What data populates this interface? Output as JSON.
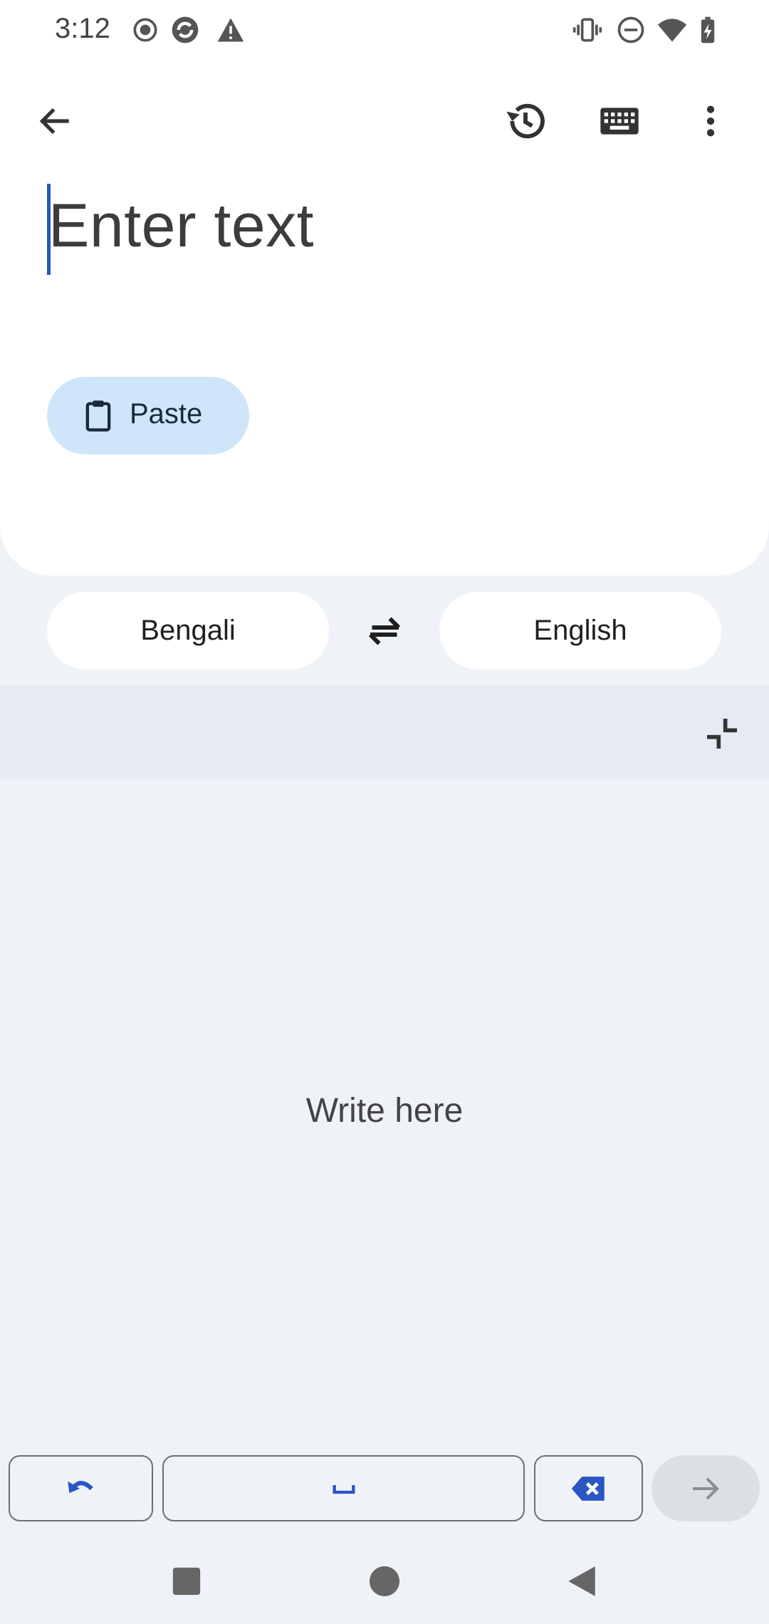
{
  "status_bar": {
    "time": "3:12",
    "left_icons": [
      "record-icon",
      "app-notification-icon",
      "warning-icon"
    ],
    "right_icons": [
      "vibrate-icon",
      "do-not-disturb-icon",
      "wifi-icon",
      "battery-charging-icon"
    ]
  },
  "toolbar": {
    "back_icon": "arrow-left-icon",
    "history_icon": "history-icon",
    "keyboard_icon": "keyboard-icon",
    "more_icon": "more-vert-icon"
  },
  "input": {
    "placeholder": "Enter text",
    "value": ""
  },
  "paste_button": {
    "label": "Paste",
    "icon": "clipboard-icon"
  },
  "languages": {
    "source": "Bengali",
    "target": "English",
    "swap_icon": "swap-arrows-icon"
  },
  "handwriting": {
    "collapse_icon": "collapse-icon",
    "hint": "Write here"
  },
  "keyboard_row": {
    "undo_icon": "undo-icon",
    "space_icon": "space-icon",
    "backspace_icon": "backspace-icon",
    "enter_icon": "arrow-right-icon"
  },
  "nav_bar": {
    "recents_icon": "square-icon",
    "home_icon": "circle-icon",
    "back_icon": "triangle-back-icon"
  },
  "colors": {
    "accent": "#2a56c6",
    "paste_bg": "#cfe6fa",
    "panel_bg": "#eff3f8",
    "header_bg": "#e6eaf2"
  }
}
